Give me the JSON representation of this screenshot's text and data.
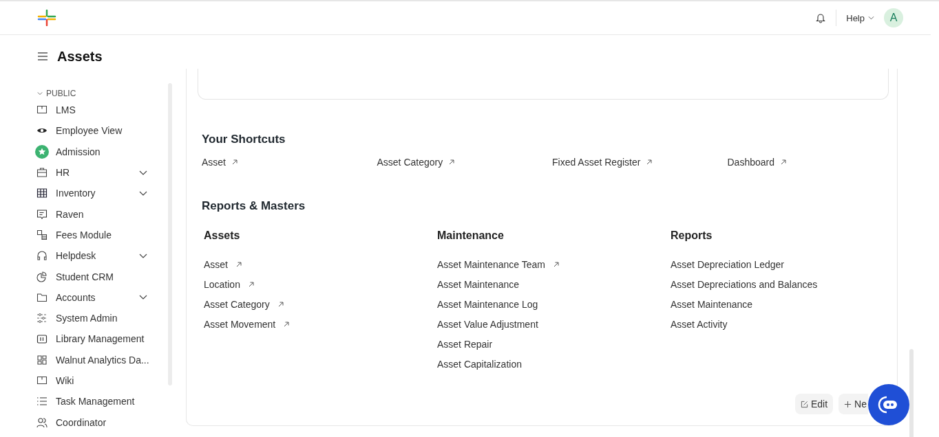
{
  "navbar": {
    "help_label": "Help",
    "avatar_initial": "A"
  },
  "page": {
    "title": "Assets"
  },
  "sidebar": {
    "section_label": "PUBLIC",
    "section_expanded": true,
    "items": [
      {
        "label": "LMS",
        "expandable": false
      },
      {
        "label": "Employee View",
        "expandable": false
      },
      {
        "label": "Admission",
        "expandable": false
      },
      {
        "label": "HR",
        "expandable": true
      },
      {
        "label": "Inventory",
        "expandable": true
      },
      {
        "label": "Raven",
        "expandable": false
      },
      {
        "label": "Fees Module",
        "expandable": false
      },
      {
        "label": "Helpdesk",
        "expandable": true
      },
      {
        "label": "Student CRM",
        "expandable": false
      },
      {
        "label": "Accounts",
        "expandable": true
      },
      {
        "label": "System Admin",
        "expandable": false
      },
      {
        "label": "Library Management",
        "expandable": false
      },
      {
        "label": "Walnut Analytics Da...",
        "expandable": false
      },
      {
        "label": "Wiki",
        "expandable": false
      },
      {
        "label": "Task Management",
        "expandable": false
      },
      {
        "label": "Coordinator",
        "expandable": false
      }
    ]
  },
  "shortcuts": {
    "title": "Your Shortcuts",
    "items": [
      "Asset",
      "Asset Category",
      "Fixed Asset Register",
      "Dashboard"
    ]
  },
  "reports": {
    "title": "Reports & Masters",
    "cards": [
      {
        "title": "Assets",
        "links": [
          {
            "label": "Asset",
            "shortcut": true
          },
          {
            "label": "Location",
            "shortcut": true
          },
          {
            "label": "Asset Category",
            "shortcut": true
          },
          {
            "label": "Asset Movement",
            "shortcut": true
          }
        ]
      },
      {
        "title": "Maintenance",
        "links": [
          {
            "label": "Asset Maintenance Team",
            "shortcut": true
          },
          {
            "label": "Asset Maintenance",
            "shortcut": false
          },
          {
            "label": "Asset Maintenance Log",
            "shortcut": false
          },
          {
            "label": "Asset Value Adjustment",
            "shortcut": false
          },
          {
            "label": "Asset Repair",
            "shortcut": false
          },
          {
            "label": "Asset Capitalization",
            "shortcut": false
          }
        ]
      },
      {
        "title": "Reports",
        "links": [
          {
            "label": "Asset Depreciation Ledger",
            "shortcut": false
          },
          {
            "label": "Asset Depreciations and Balances",
            "shortcut": false
          },
          {
            "label": "Asset Maintenance",
            "shortcut": false
          },
          {
            "label": "Asset Activity",
            "shortcut": false
          }
        ]
      }
    ]
  },
  "actions": {
    "edit_label": "Edit",
    "new_label": "Ne"
  }
}
